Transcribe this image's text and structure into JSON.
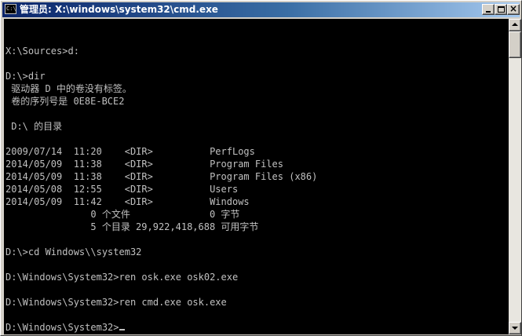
{
  "window": {
    "title": "管理员: X:\\windows\\system32\\cmd.exe",
    "icon": "console-icon",
    "icon_text": "C:\\",
    "buttons": {
      "minimize": "minimize-icon",
      "maximize": "maximize-icon",
      "close_glyph": "×"
    }
  },
  "console": {
    "foreground": "#c0c0c0",
    "background": "#000000",
    "lines": [
      "",
      "",
      "X:\\Sources>d:",
      "",
      "D:\\>dir",
      " 驱动器 D 中的卷没有标签。",
      " 卷的序列号是 0E8E-BCE2",
      "",
      " D:\\ 的目录",
      "",
      "2009/07/14  11:20    <DIR>          PerfLogs",
      "2014/05/09  11:38    <DIR>          Program Files",
      "2014/05/09  11:38    <DIR>          Program Files (x86)",
      "2014/05/08  12:55    <DIR>          Users",
      "2014/05/09  11:42    <DIR>          Windows",
      "               0 个文件              0 字节",
      "               5 个目录 29,922,418,688 可用字节",
      "",
      "D:\\>cd Windows\\\\system32",
      "",
      "D:\\Windows\\System32>ren osk.exe osk02.exe",
      "",
      "D:\\Windows\\System32>ren cmd.exe osk.exe",
      "",
      "D:\\Windows\\System32>"
    ]
  },
  "scrollbar": {
    "up": "scroll-up-arrow-icon",
    "down": "scroll-down-arrow-icon"
  }
}
